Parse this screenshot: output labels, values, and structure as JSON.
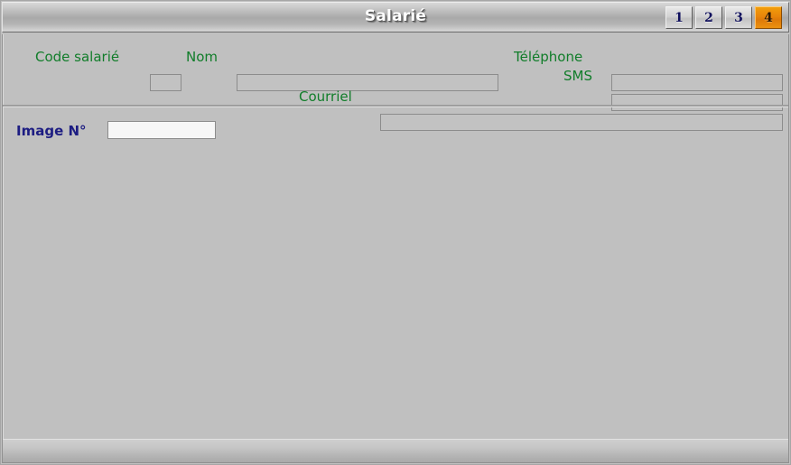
{
  "window": {
    "title": "Salarié"
  },
  "tabs": [
    {
      "label": "1",
      "active": false
    },
    {
      "label": "2",
      "active": false
    },
    {
      "label": "3",
      "active": false
    },
    {
      "label": "4",
      "active": true
    }
  ],
  "form": {
    "code_salarie": {
      "label": "Code salarié",
      "value": "",
      "placeholder": ""
    },
    "nom": {
      "label": "Nom",
      "value": "",
      "placeholder": ""
    },
    "telephone": {
      "label": "Téléphone",
      "value": "",
      "placeholder": ""
    },
    "sms": {
      "label": "SMS",
      "value": "",
      "placeholder": ""
    },
    "courriel": {
      "label": "Courriel",
      "value": "",
      "placeholder": ""
    }
  },
  "image_section": {
    "image_number": {
      "label": "Image N°",
      "value": "",
      "placeholder": ""
    }
  },
  "statusbar": {
    "text": ""
  },
  "colors": {
    "label_green": "#117d2a",
    "label_navy": "#1d1d82",
    "active_tab_orange": "#e8840a",
    "window_face": "#c0c0c0",
    "field_face": "#c2c2c2",
    "field_active": "#f7f7f7"
  }
}
